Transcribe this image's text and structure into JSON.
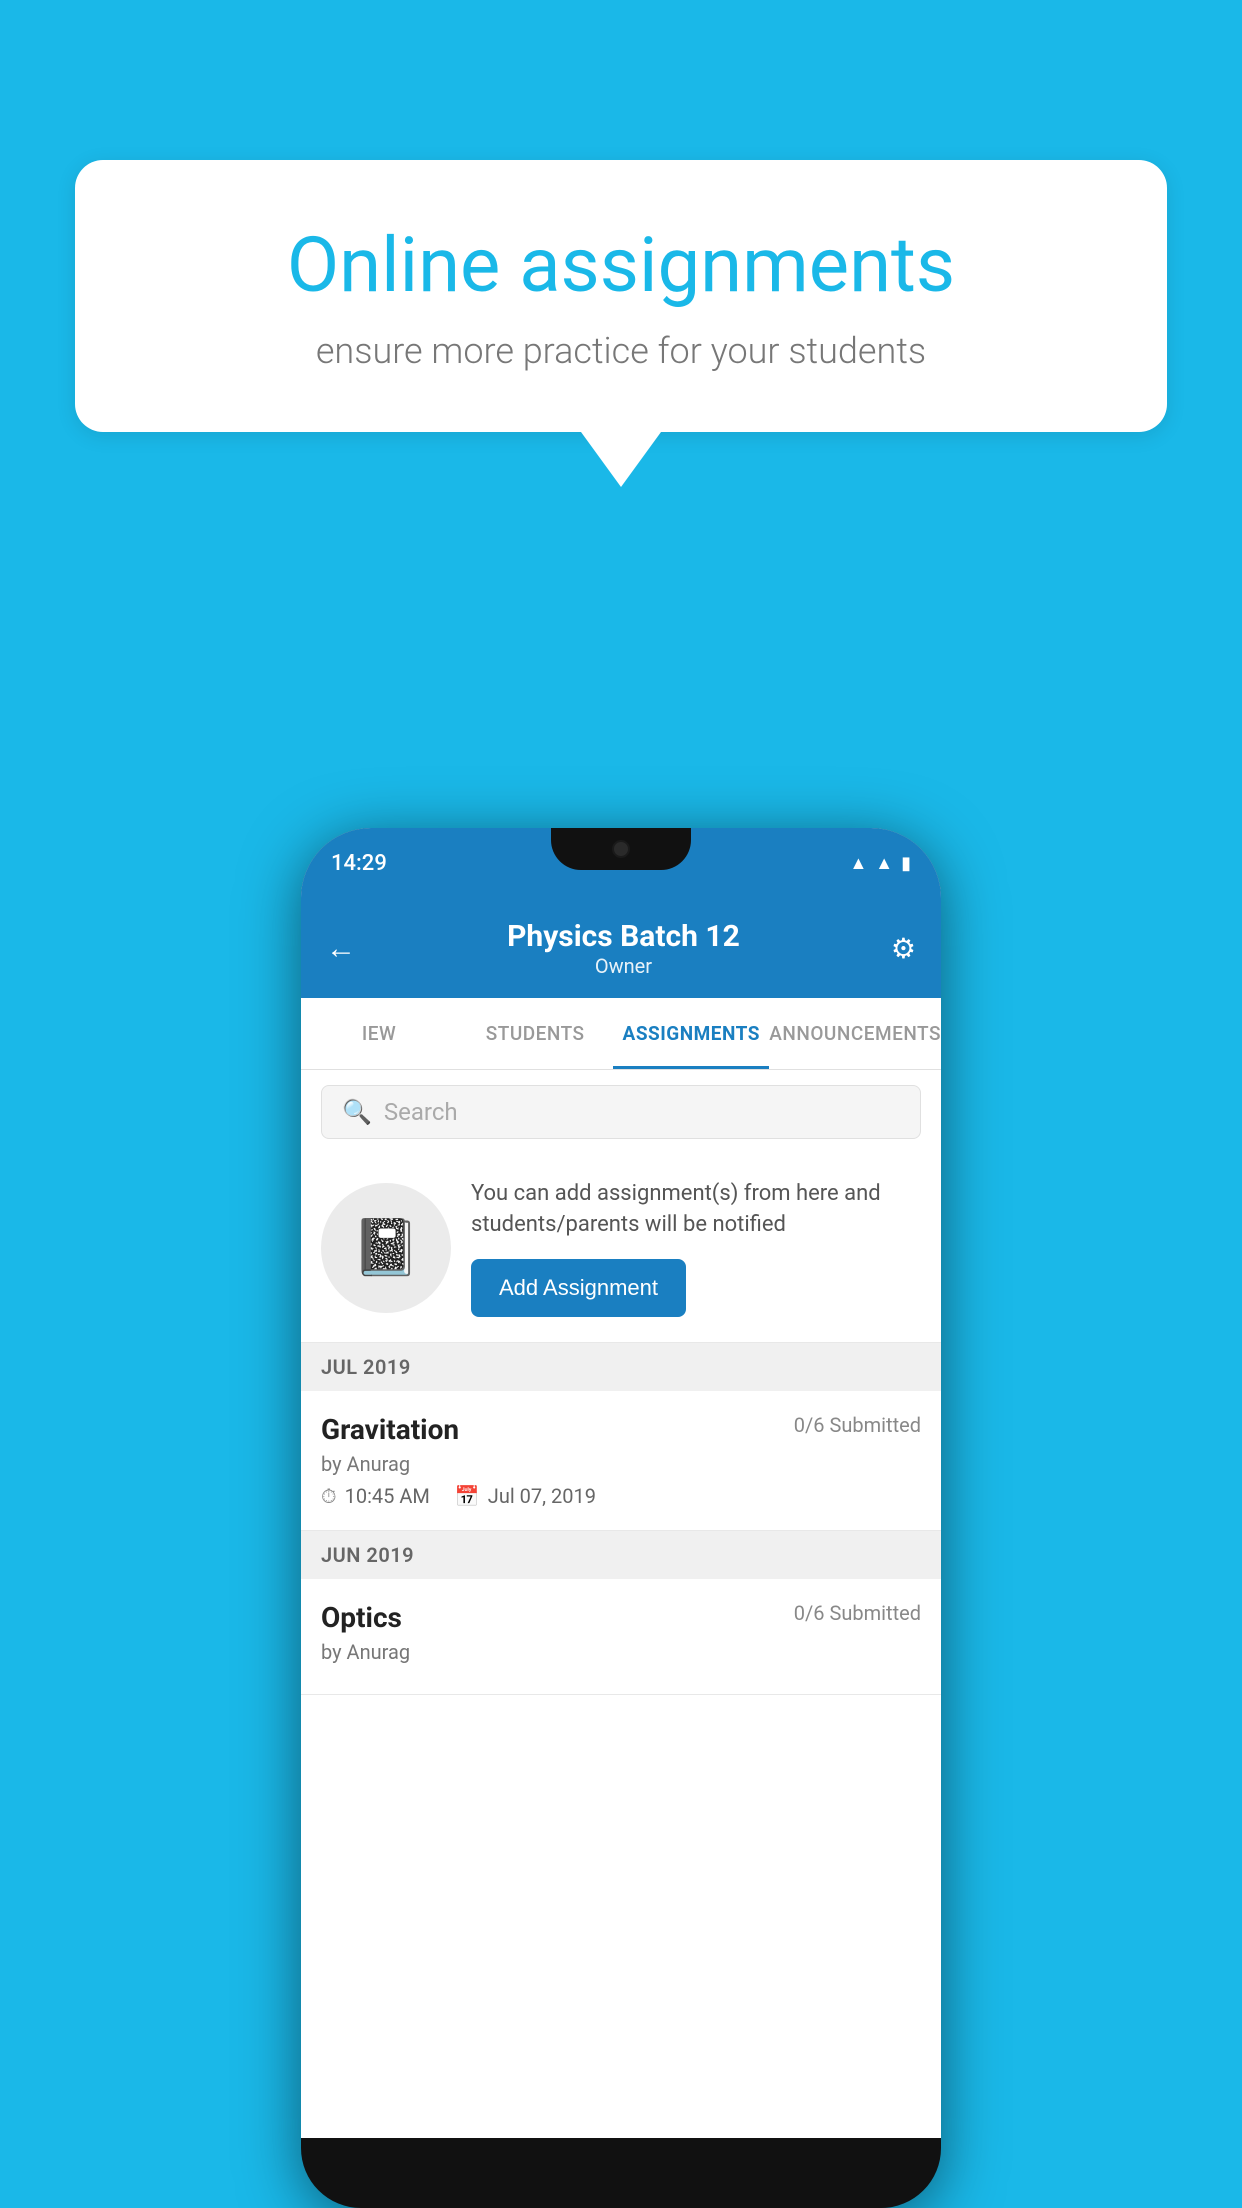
{
  "background": {
    "color": "#1ab8e8"
  },
  "speech_bubble": {
    "title": "Online assignments",
    "subtitle": "ensure more practice for your students"
  },
  "phone": {
    "status_bar": {
      "time": "14:29",
      "icons": [
        "wifi",
        "signal",
        "battery"
      ]
    },
    "header": {
      "title": "Physics Batch 12",
      "subtitle": "Owner",
      "back_label": "←",
      "settings_label": "⚙"
    },
    "tabs": [
      {
        "label": "IEW",
        "active": false
      },
      {
        "label": "STUDENTS",
        "active": false
      },
      {
        "label": "ASSIGNMENTS",
        "active": true
      },
      {
        "label": "ANNOUNCEMENTS",
        "active": false
      }
    ],
    "search": {
      "placeholder": "Search"
    },
    "add_assignment_prompt": {
      "description": "You can add assignment(s) from here and students/parents will be notified",
      "button_label": "Add Assignment"
    },
    "sections": [
      {
        "month": "JUL 2019",
        "assignments": [
          {
            "name": "Gravitation",
            "submitted": "0/6 Submitted",
            "by": "by Anurag",
            "time": "10:45 AM",
            "date": "Jul 07, 2019"
          }
        ]
      },
      {
        "month": "JUN 2019",
        "assignments": [
          {
            "name": "Optics",
            "submitted": "0/6 Submitted",
            "by": "by Anurag",
            "time": "",
            "date": ""
          }
        ]
      }
    ]
  }
}
